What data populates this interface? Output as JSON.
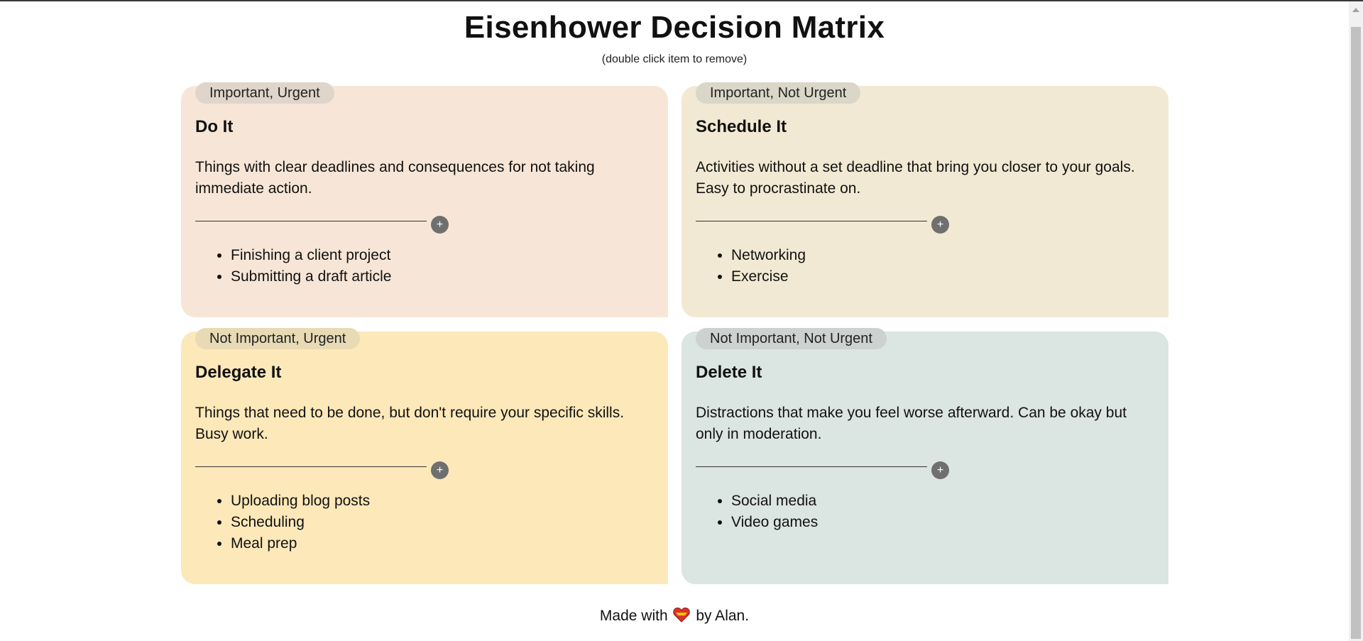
{
  "header": {
    "title": "Eisenhower Decision Matrix",
    "subtitle": "(double click item to remove)"
  },
  "quadrants": [
    {
      "tag": "Important, Urgent",
      "title": "Do It",
      "description": "Things with clear deadlines and consequences for not taking immediate action.",
      "add_label": "+",
      "items": [
        "Finishing a client project",
        "Submitting a draft article"
      ]
    },
    {
      "tag": "Important, Not Urgent",
      "title": "Schedule It",
      "description": "Activities without a set deadline that bring you closer to your goals. Easy to procrastinate on.",
      "add_label": "+",
      "items": [
        "Networking",
        "Exercise"
      ]
    },
    {
      "tag": "Not Important, Urgent",
      "title": "Delegate It",
      "description": "Things that need to be done, but don't require your specific skills. Busy work.",
      "add_label": "+",
      "items": [
        "Uploading blog posts",
        "Scheduling",
        "Meal prep"
      ]
    },
    {
      "tag": "Not Important, Not Urgent",
      "title": "Delete It",
      "description": "Distractions that make you feel worse afterward. Can be okay but only in moderation.",
      "add_label": "+",
      "items": [
        "Social media",
        "Video games"
      ]
    }
  ],
  "footer": {
    "prefix": "Made with",
    "icon": "heart-icon",
    "suffix": "by Alan."
  },
  "colors": {
    "do_it_bg": "#f7e6d7",
    "schedule_it_bg": "#f1e9d3",
    "delegate_it_bg": "#fde8b9",
    "delete_it_bg": "#dbe5e1",
    "add_button": "#6f6f6f"
  }
}
